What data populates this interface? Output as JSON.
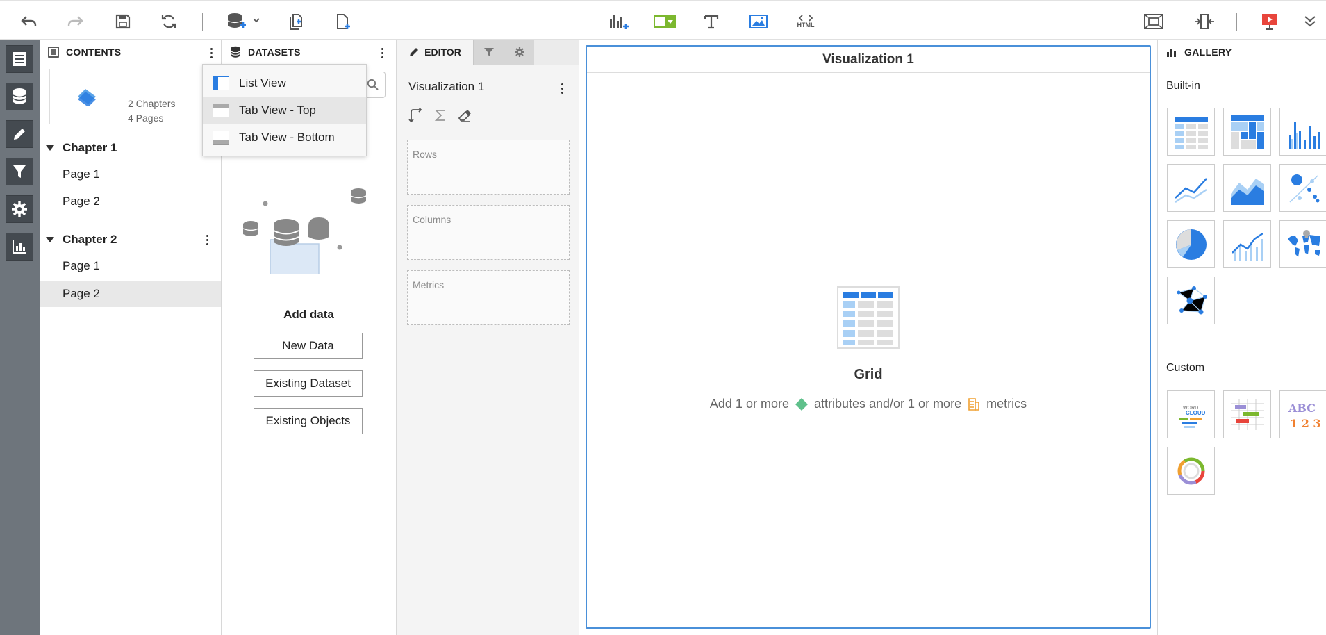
{
  "toolbar": {
    "undo": "undo-icon",
    "redo": "redo-icon",
    "save": "save-icon",
    "refresh": "refresh-icon",
    "add_data": "add-data-icon",
    "duplicate_page": "duplicate-page-icon",
    "new_page": "new-page-icon",
    "insert_viz": "insert-visualization-icon",
    "filter_selector": "filter-selector-icon",
    "text": "text-icon",
    "image": "image-icon",
    "html_label": "HTML",
    "fit": "fit-to-screen-icon",
    "responsive": "responsive-icon",
    "present": "presentation-icon",
    "more": "collapse-toolbar-icon",
    "accent": "#4a90d9"
  },
  "contents": {
    "title": "CONTENTS",
    "summary_chapters": "2 Chapters",
    "summary_pages": "4 Pages",
    "chapters": [
      {
        "label": "Chapter 1",
        "pages": [
          "Page 1",
          "Page 2"
        ]
      },
      {
        "label": "Chapter 2",
        "pages": [
          "Page 1",
          "Page 2"
        ]
      }
    ]
  },
  "dropdown": {
    "items": [
      "List View",
      "Tab View - Top",
      "Tab View - Bottom"
    ]
  },
  "datasets": {
    "title": "DATASETS",
    "add_title": "Add data",
    "buttons": [
      "New Data",
      "Existing Dataset",
      "Existing Objects"
    ]
  },
  "editor": {
    "tab_label": "EDITOR",
    "viz_name": "Visualization 1",
    "zones": [
      "Rows",
      "Columns",
      "Metrics"
    ]
  },
  "canvas": {
    "viz_title": "Visualization 1",
    "grid_title": "Grid",
    "hint_prefix": "Add 1 or more",
    "hint_attr": "attributes and/or 1 or more",
    "hint_metrics": "metrics"
  },
  "gallery": {
    "title": "GALLERY",
    "builtin": "Built-in",
    "custom": "Custom"
  }
}
